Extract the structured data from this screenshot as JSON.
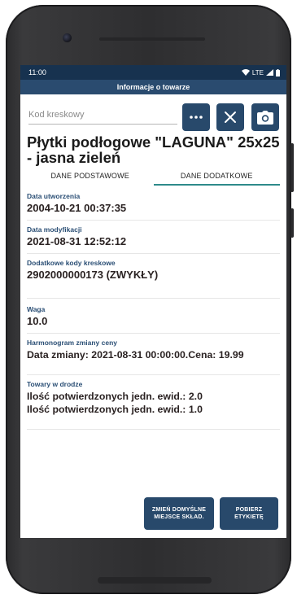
{
  "status_bar": {
    "time": "11:00",
    "network": "LTE"
  },
  "app_bar": {
    "title": "Informacje o towarze"
  },
  "search": {
    "placeholder": "Kod kreskowy",
    "value": ""
  },
  "toolbar": {
    "more_icon": "more-dots-icon",
    "clear_icon": "close-icon",
    "camera_icon": "camera-icon"
  },
  "product": {
    "name": "Płytki podłogowe \"LAGUNA\" 25x25 - jasna zieleń"
  },
  "tabs": [
    {
      "label": "DANE PODSTAWOWE",
      "active": false
    },
    {
      "label": "DANE DODATKOWE",
      "active": true
    }
  ],
  "details": {
    "created": {
      "label": "Data utworzenia",
      "value": "2004-10-21 00:37:35"
    },
    "modified": {
      "label": "Data modyfikacji",
      "value": "2021-08-31 12:52:12"
    },
    "barcodes": {
      "label": "Dodatkowe kody kreskowe",
      "value": "2902000000173 (ZWYKŁY)"
    },
    "weight": {
      "label": "Waga",
      "value": "10.0"
    },
    "price_schedule": {
      "label": "Harmonogram zmiany ceny",
      "value": "Data zmiany: 2021-08-31 00:00:00.Cena: 19.99"
    },
    "in_transit": {
      "label": "Towary w drodze",
      "lines": [
        "Ilość potwierdzonych jedn. ewid.: 2.0",
        "Ilość potwierdzonych jedn. ewid.: 1.0"
      ]
    }
  },
  "actions": {
    "change_location": {
      "line1": "ZMIEŃ DOMYŚLNE",
      "line2": "MIEJSCE SKŁAD."
    },
    "get_label": {
      "line1": "POBIERZ",
      "line2": "ETYKIETĘ"
    }
  },
  "colors": {
    "primary": "#28496b",
    "status_bar": "#17324f",
    "tab_indicator": "#2e8a8a",
    "label": "#2b4f75"
  }
}
